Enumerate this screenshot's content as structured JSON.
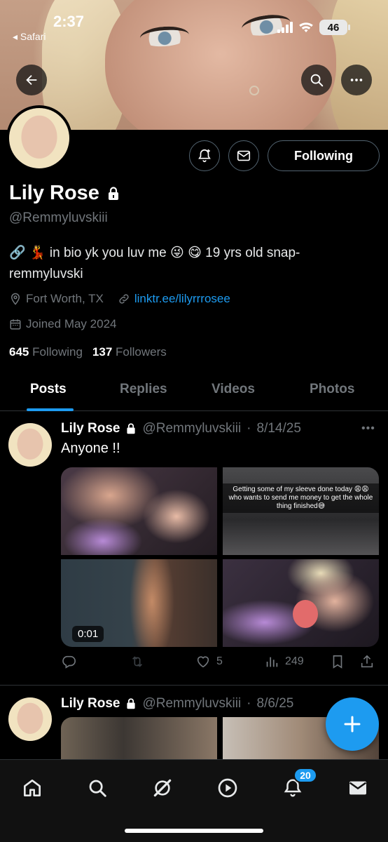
{
  "status_bar": {
    "time": "2:37",
    "back_app": "◂ Safari",
    "battery": "46"
  },
  "profile": {
    "name": "Lily Rose",
    "handle": "@Remmyluvskiii",
    "bio": "🔗 💃 in bio yk you luv me 😜 😋 19 yrs old snap- remmyluvski",
    "location": "Fort Worth, TX",
    "link": "linktr.ee/lilyrrrosee",
    "joined": "Joined May 2024",
    "following_count": "645",
    "following_label": "Following",
    "followers_count": "137",
    "followers_label": "Followers",
    "follow_button": "Following"
  },
  "tabs": [
    "Posts",
    "Replies",
    "Videos",
    "Photos"
  ],
  "active_tab": "Posts",
  "posts": [
    {
      "name": "Lily Rose",
      "handle": "@Remmyluvskiii",
      "date": "8/14/25",
      "text": "Anyone !!",
      "media_caption": "Getting some of my sleeve done today 😩😩 who wants to send me money to get the whole thing finished😅",
      "video_duration": "0:01",
      "likes": "5",
      "views": "249"
    },
    {
      "name": "Lily Rose",
      "handle": "@Remmyluvskiii",
      "date": "8/6/25"
    }
  ],
  "notifications_badge": "20",
  "colors": {
    "accent": "#1d9bf0",
    "muted": "#71767b",
    "background": "#000000",
    "divider": "#2f3336"
  },
  "icons": [
    "back-arrow-icon",
    "search-icon",
    "more-icon",
    "lock-icon",
    "bell-plus-icon",
    "mail-icon",
    "location-pin-icon",
    "link-icon",
    "calendar-icon",
    "reply-icon",
    "retweet-icon",
    "heart-icon",
    "views-icon",
    "bookmark-icon",
    "share-icon",
    "plus-icon",
    "home-icon",
    "grok-icon",
    "play-icon",
    "bell-icon",
    "mail-icon"
  ]
}
